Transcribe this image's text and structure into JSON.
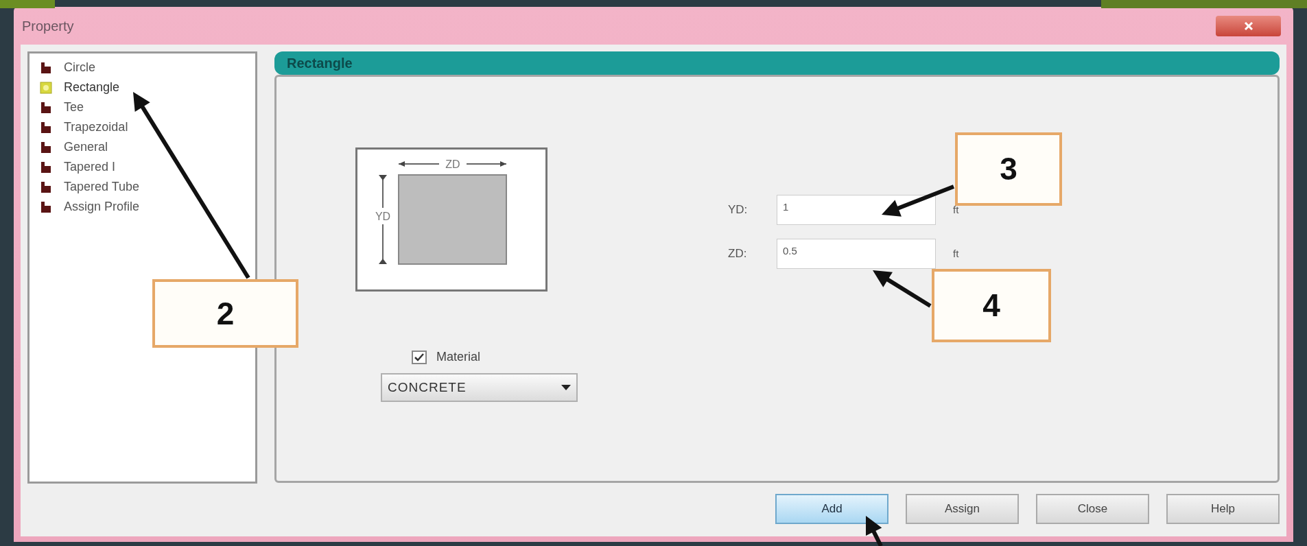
{
  "window": {
    "title": "Property"
  },
  "tree": {
    "items": [
      {
        "label": "Circle",
        "selected": false
      },
      {
        "label": "Rectangle",
        "selected": true
      },
      {
        "label": "Tee",
        "selected": false
      },
      {
        "label": "Trapezoidal",
        "selected": false
      },
      {
        "label": "General",
        "selected": false
      },
      {
        "label": "Tapered I",
        "selected": false
      },
      {
        "label": "Tapered Tube",
        "selected": false
      },
      {
        "label": "Assign Profile",
        "selected": false
      }
    ]
  },
  "panel": {
    "title": "Rectangle",
    "diagram": {
      "width_label": "ZD",
      "height_label": "YD"
    },
    "material": {
      "label": "Material",
      "checked": true
    },
    "material_select": {
      "value": "CONCRETE"
    },
    "fields": [
      {
        "label": "YD:",
        "value": "1",
        "unit": "ft"
      },
      {
        "label": "ZD:",
        "value": "0.5",
        "unit": "ft"
      }
    ]
  },
  "buttons": [
    {
      "label": "Add",
      "default": true
    },
    {
      "label": "Assign",
      "default": false
    },
    {
      "label": "Close",
      "default": false
    },
    {
      "label": "Help",
      "default": false
    }
  ],
  "annotations": [
    {
      "label": "2"
    },
    {
      "label": "3"
    },
    {
      "label": "4"
    }
  ]
}
